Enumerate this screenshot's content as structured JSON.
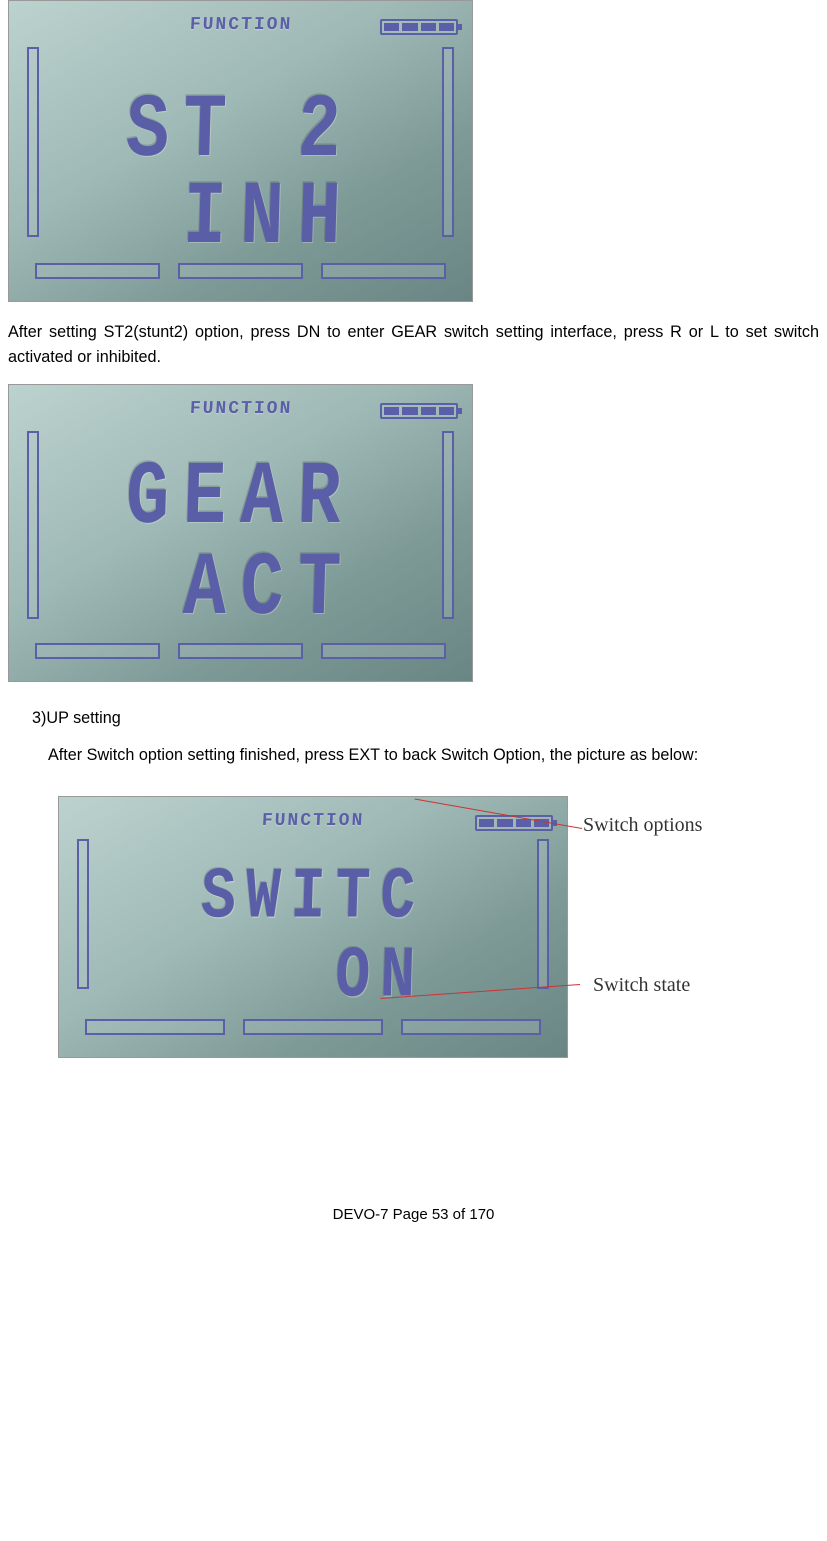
{
  "images": {
    "first": {
      "header": "FUNCTION",
      "row1": "ST 2",
      "row2": " INH"
    },
    "second": {
      "header": "FUNCTION",
      "row1": "GEAR",
      "row2": " ACT"
    },
    "third": {
      "header": "FUNCTION",
      "row1": "SWITC",
      "row2": "   ON"
    }
  },
  "paragraphs": {
    "p1": "After setting ST2(stunt2) option, press DN to enter GEAR switch setting interface, press R or L to set switch activated or inhibited.",
    "heading": "3)UP setting",
    "p2": "After Switch option setting finished, press EXT to back Switch Option, the picture as below:"
  },
  "callouts": {
    "c1": "Switch options",
    "c2": "Switch state"
  },
  "footer": "DEVO-7     Page 53 of 170"
}
